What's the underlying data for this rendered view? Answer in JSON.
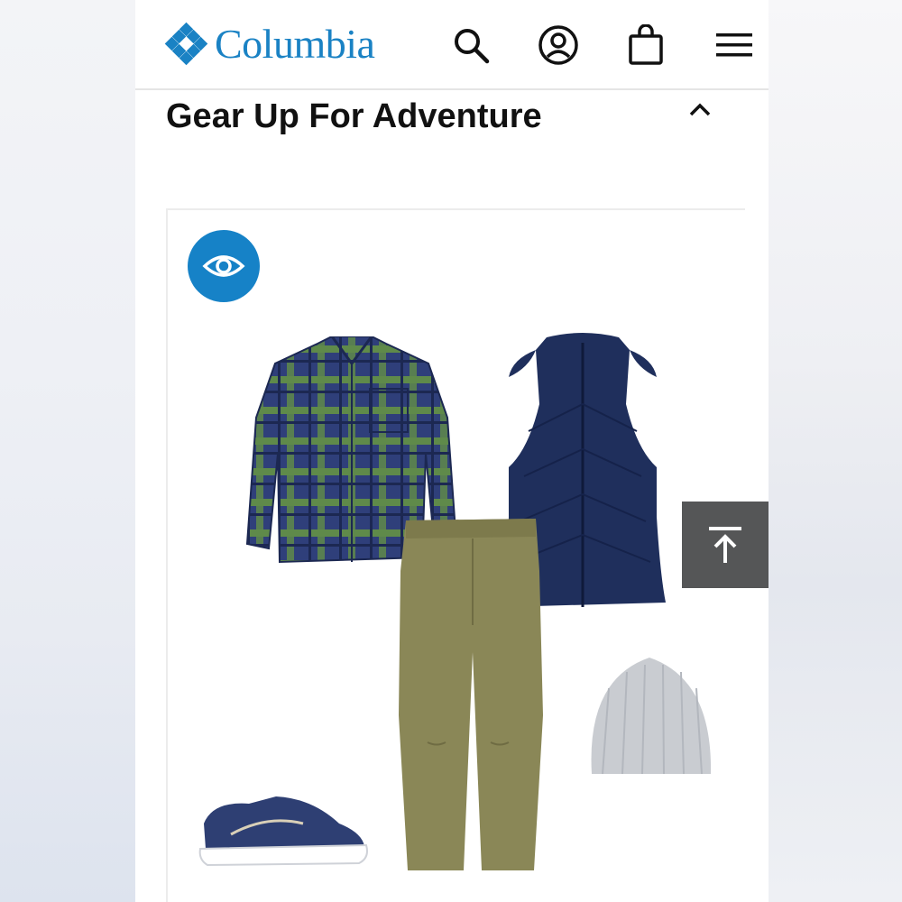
{
  "header": {
    "brand": "Columbia",
    "icons": [
      "search-icon",
      "account-icon",
      "shopping-bag-icon",
      "menu-icon"
    ]
  },
  "section": {
    "title": "Gear Up For Adventure",
    "collapse_icon": "chevron-up-icon"
  },
  "outfit": {
    "view_icon": "eye-icon",
    "products": [
      {
        "kind": "shirt",
        "color": "#2f4a78"
      },
      {
        "kind": "vest",
        "color": "#1f2f5c"
      },
      {
        "kind": "pants",
        "color": "#8a8757"
      },
      {
        "kind": "beanie",
        "color": "#c9ccd1"
      },
      {
        "kind": "shoe",
        "color": "#2e3f73"
      }
    ]
  },
  "back_to_top": {
    "icon": "arrow-up-to-line-icon"
  },
  "colors": {
    "brand_blue": "#1a82c4",
    "eye_button": "#1682c7",
    "back_to_top_bg": "#555657"
  }
}
